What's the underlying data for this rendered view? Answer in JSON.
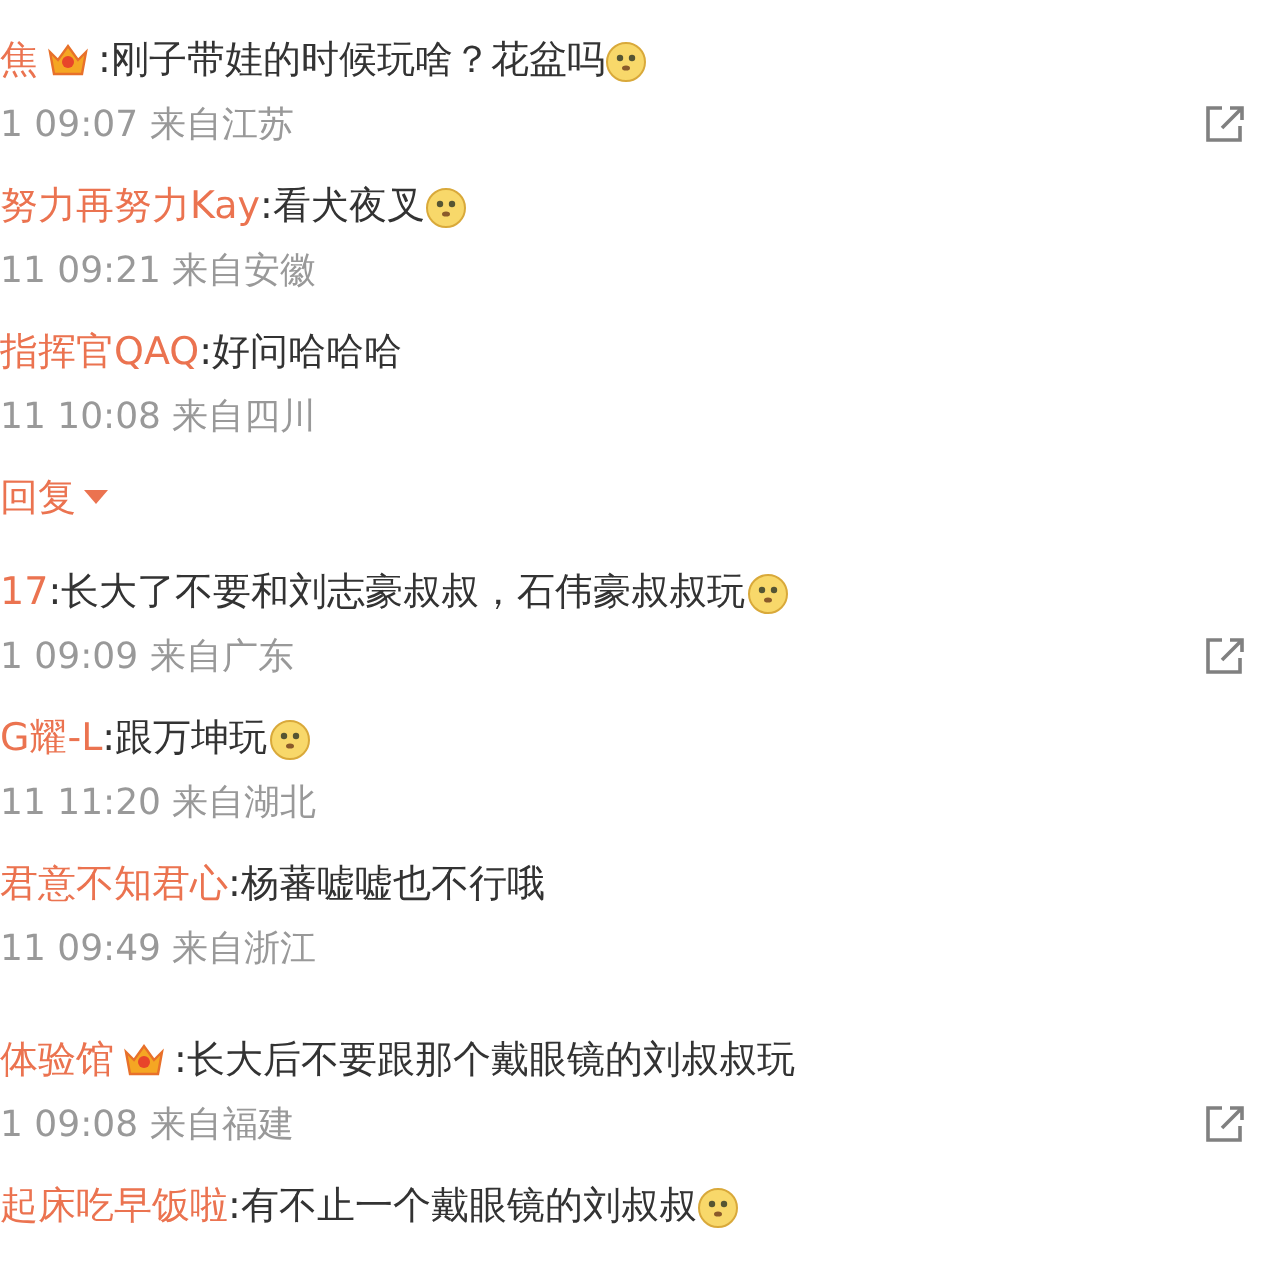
{
  "comments": [
    {
      "kind": "main",
      "user": "焦",
      "badge": true,
      "text": ":刚子带娃的时候玩啥？花盆吗",
      "emoji": true,
      "time": "1 09:07 来自江苏"
    },
    {
      "kind": "reply",
      "user": "努力再努力Kay",
      "badge": false,
      "text": ":看犬夜叉",
      "emoji": true,
      "time": "11 09:21 来自安徽"
    },
    {
      "kind": "reply",
      "user": "指挥官QAQ",
      "badge": false,
      "text": ":好问哈哈哈",
      "emoji": false,
      "time": "11 10:08 来自四川"
    },
    {
      "kind": "more",
      "label": "回复"
    },
    {
      "kind": "main",
      "user": "17",
      "badge": false,
      "text": ":长大了不要和刘志豪叔叔，石伟豪叔叔玩",
      "emoji": true,
      "time": "1 09:09 来自广东"
    },
    {
      "kind": "reply",
      "user": "G耀-L",
      "badge": false,
      "text": ":跟万坤玩",
      "emoji": true,
      "time": "11 11:20 来自湖北"
    },
    {
      "kind": "reply",
      "user": "君意不知君心",
      "badge": false,
      "text": ":杨蕃嘘嘘也不行哦",
      "emoji": false,
      "time": "11 09:49 来自浙江"
    },
    {
      "kind": "main",
      "user": "体验馆",
      "badge": true,
      "text": ":长大后不要跟那个戴眼镜的刘叔叔玩",
      "emoji": false,
      "time": "1 09:08 来自福建"
    },
    {
      "kind": "reply",
      "user": "起床吃早饭啦",
      "badge": false,
      "text": ":有不止一个戴眼镜的刘叔叔",
      "emoji": true
    }
  ]
}
